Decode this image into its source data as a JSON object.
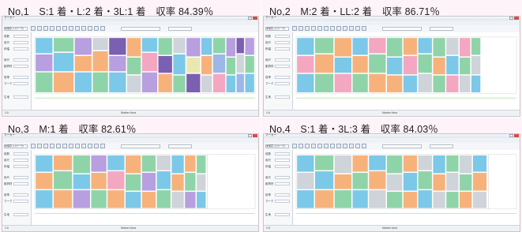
{
  "panels": [
    {
      "title": "No,1　S:1 着・L:2 着・3L:1 着　収率 84.39％",
      "window": {
        "app_title": "マーカー",
        "doc_name": "未保存_0 [ワーク]",
        "menu": [
          "ファイル",
          "編集",
          "表示",
          "配置",
          "マーカー",
          "ツール",
          "ウィンドウ",
          "ヘルプ"
        ],
        "left_labels": [
          "段数",
          "用尺",
          "布幅",
          "用尺",
          "副資材",
          "倍率",
          "マーク",
          "生地"
        ],
        "status_left": "1:0",
        "status_right": "Marker Area"
      }
    },
    {
      "title": "No,2　M:2 着・LL:2 着　収率 86.71％",
      "window": {
        "app_title": "マーカー",
        "doc_name": "未保存_0 [ワーク]",
        "menu": [
          "ファイル",
          "編集",
          "表示",
          "配置",
          "マーカー",
          "ツール",
          "ウィンドウ",
          "ヘルプ"
        ],
        "left_labels": [
          "段数",
          "用尺",
          "布幅",
          "用尺",
          "副資材",
          "倍率",
          "マーク",
          "生地"
        ],
        "status_left": "1:0",
        "status_right": "Marker Area"
      }
    },
    {
      "title": "No,3　M:1 着　収率 82.61％",
      "window": {
        "app_title": "マーカー",
        "doc_name": "未保存_0 [ワーク]",
        "menu": [
          "ファイル",
          "編集",
          "表示",
          "配置",
          "マーカー",
          "ツール",
          "ウィンドウ",
          "ヘルプ"
        ],
        "left_labels": [
          "段数",
          "用尺",
          "布幅",
          "用尺",
          "副資材",
          "倍率",
          "マーク",
          "生地"
        ],
        "status_left": "1:0",
        "status_right": "Marker Area"
      }
    },
    {
      "title": "No,4　S:1 着・3L:3 着　収率 84.03％",
      "window": {
        "app_title": "マーカー",
        "doc_name": "未保存_0 [ワーク]",
        "menu": [
          "ファイル",
          "編集",
          "表示",
          "配置",
          "マーカー",
          "ツール",
          "ウィンドウ",
          "ヘルプ"
        ],
        "left_labels": [
          "段数",
          "用尺",
          "布幅",
          "用尺",
          "副資材",
          "倍率",
          "マーク",
          "生地"
        ],
        "status_left": "1:0",
        "status_right": "Marker Area"
      }
    }
  ],
  "colors": {
    "panel_bg": "#fdf3f8",
    "piece_palette": [
      "#7cc8e8",
      "#f7b27c",
      "#8fd4a8",
      "#b79fe0",
      "#cfd3da",
      "#f4a7c0",
      "#e8e8b0",
      "#9bb8e8"
    ],
    "accent_dark_purple": "#7b5fb0"
  }
}
